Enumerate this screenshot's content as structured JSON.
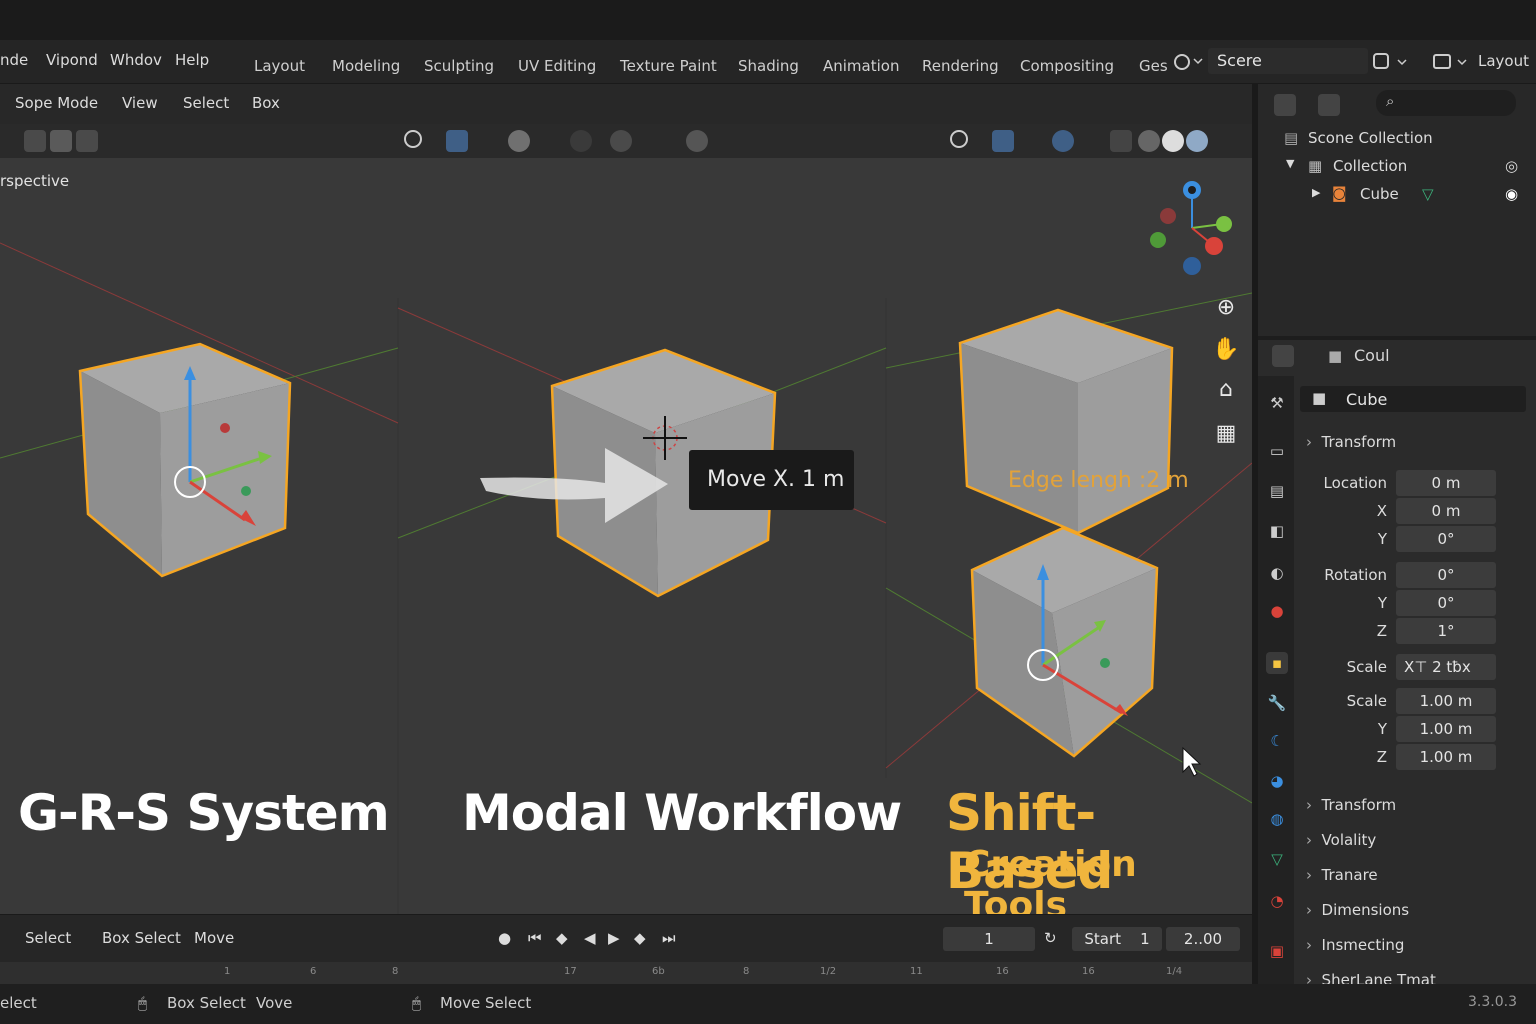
{
  "menubar": {
    "items": [
      "nde",
      "Vipond",
      "Whdov",
      "Help"
    ],
    "workspaces": [
      "Layout",
      "Modeling",
      "Sculpting",
      "UV Editing",
      "Texture Paint",
      "Shading",
      "Animation",
      "Rendering",
      "Compositing",
      "Ges"
    ],
    "scene_name": "Scere",
    "layout_label": "Layout"
  },
  "viewport_header": {
    "items": [
      "Sope Mode",
      "View",
      "Select",
      "Box"
    ]
  },
  "viewport": {
    "perspective_label": "rspective",
    "tooltip": "Move X. 1 m",
    "edge_label": "Edge lengh :2 m",
    "captions": {
      "left": "G-R-S System",
      "middle": "Modal Workflow",
      "right_title": "Shift-Based",
      "right_sub": "Creation Tools"
    }
  },
  "outliner": {
    "scene_collection": "Scone Collection",
    "collection": "Collection",
    "object": "Cube"
  },
  "properties": {
    "header_name": "Coul",
    "object_name": "Cube",
    "sections": {
      "transform": "Transform",
      "transform2": "Transform",
      "volatility": "Volality",
      "tranare": "Tranare",
      "dimensions": "Dimensions",
      "insmecting": "Insmecting",
      "last": "SherLane Tmat"
    },
    "location_label": "Location",
    "location": [
      "0 m",
      "0 m",
      "0°"
    ],
    "rotation_label": "Rotation",
    "rotation": [
      "0°",
      "0°",
      "1°"
    ],
    "scale_mode_label": "Scale",
    "scale_mode": "X⊤ 2 tƀx",
    "scale_label": "Scale",
    "scale": [
      "1.00 m",
      "1.00 m",
      "1.00 m"
    ],
    "axis": {
      "x": "X",
      "y": "Y",
      "z": "Z"
    }
  },
  "timeline": {
    "select": "Select",
    "box_select": "Box Select",
    "move": "Move",
    "current_frame": "1",
    "start_label": "Start",
    "start_value": "1",
    "end_value": "2..00",
    "ruler_ticks": [
      "1",
      "6",
      "8",
      "17",
      "6b",
      "8",
      "1/2",
      "11",
      "16",
      "16",
      "1/4"
    ]
  },
  "statusbar": {
    "select": "elect",
    "box_select": "Box Select",
    "vove": "Vove",
    "move_select": "Move Select",
    "version": "3.3.0.3"
  },
  "colors": {
    "accent_orange": "#f0b53d",
    "selection_outline": "#f5a623",
    "axis_x": "#d9433a",
    "axis_y": "#7ac142",
    "axis_z": "#3b8fe0"
  }
}
